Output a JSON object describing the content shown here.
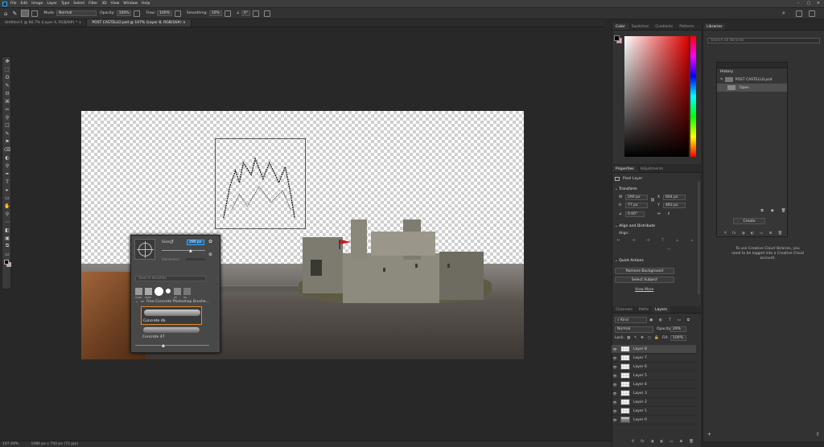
{
  "menu": {
    "app_icon": "Ps",
    "items": [
      "File",
      "Edit",
      "Image",
      "Layer",
      "Type",
      "Select",
      "Filter",
      "3D",
      "View",
      "Window",
      "Help"
    ],
    "window_controls": [
      "–",
      "▢",
      "✕"
    ]
  },
  "options": {
    "mode_label": "Mode:",
    "mode_value": "Normal",
    "opacity_label": "Opacity:",
    "opacity_value": "100%",
    "flow_label": "Flow:",
    "flow_value": "100%",
    "smoothing_label": "Smoothing:",
    "smoothing_value": "10%",
    "angle_value": "0°"
  },
  "tabs": [
    {
      "label": "Untitled-1 @ 66.7% (Layer 4, RGB/8#) *",
      "close": "×"
    },
    {
      "label": "POST CASTELLO.psd @ 107% (Layer 8, RGB/16#)",
      "close": "×"
    }
  ],
  "tools": [
    "✥",
    "⬚",
    "ʘ",
    "✎",
    "⊡",
    "⌘",
    "✂",
    "⚲",
    "☐",
    "✎",
    "⚑",
    "⌫",
    "◐",
    "⚲",
    "✒",
    "T",
    "▸",
    "▭",
    "✋",
    "⚲",
    "⋯",
    "◧",
    "▣",
    "⧉",
    "▭"
  ],
  "brush_panel": {
    "size_label": "Size:",
    "size_value": "290 px",
    "hardness_label": "Hardness:",
    "search_placeholder": "Search Brushes",
    "presets": [
      "1200",
      "2500",
      "",
      "",
      "25",
      "30"
    ],
    "folder_label": "Free Concrete Photoshop Brushe...",
    "brushes": [
      "Concrete 4b",
      "Concrete 47"
    ]
  },
  "color_panel": {
    "tabs": [
      "Color",
      "Swatches",
      "Gradients",
      "Patterns"
    ]
  },
  "libraries_panel": {
    "tab": "Libraries",
    "search_placeholder": "Search all libraries",
    "message": "To use Creative Cloud libraries, you need to be logged into a Creative Cloud account."
  },
  "history_panel": {
    "title": "History",
    "snapshot_label": "POST CASTELLO.psd",
    "items": [
      "Open"
    ],
    "create_button": "Create"
  },
  "properties_panel": {
    "tabs": [
      "Properties",
      "Adjustments"
    ],
    "layer_type": "Pixel Layer",
    "transform_title": "Transform",
    "w_label": "W",
    "w_value": "290 px",
    "h_label": "H",
    "h_value": "77 px",
    "x_label": "X",
    "x_value": "664 px",
    "y_label": "Y",
    "y_value": "483 px",
    "angle_value": "0.00°",
    "align_title": "Align and Distribute",
    "align_label": "Align:",
    "more": "···",
    "quick_actions_title": "Quick Actions",
    "actions": [
      "Remove Background",
      "Select Subject"
    ],
    "view_more": "View More"
  },
  "layers_panel": {
    "tabs": [
      "Channels",
      "Paths",
      "Layers"
    ],
    "filter_label": "Kind",
    "blend_mode": "Normal",
    "opacity_label": "Opacity:",
    "opacity_value": "29%",
    "lock_label": "Lock:",
    "fill_label": "Fill:",
    "fill_value": "100%",
    "layers": [
      "Layer 8",
      "Layer 7",
      "Layer 6",
      "Layer 5",
      "Layer 4",
      "Layer 3",
      "Layer 2",
      "Layer 1",
      "Layer 0"
    ],
    "selected_index": 0
  },
  "status": {
    "zoom": "107.49%",
    "doc_size": "1080 px x 750 px (72 ppi)"
  },
  "colors": {
    "flag": "#c81e1e",
    "accent": "#31a8ff",
    "foreground_swatch": "#000000",
    "background_swatch": "#e89ab0"
  }
}
